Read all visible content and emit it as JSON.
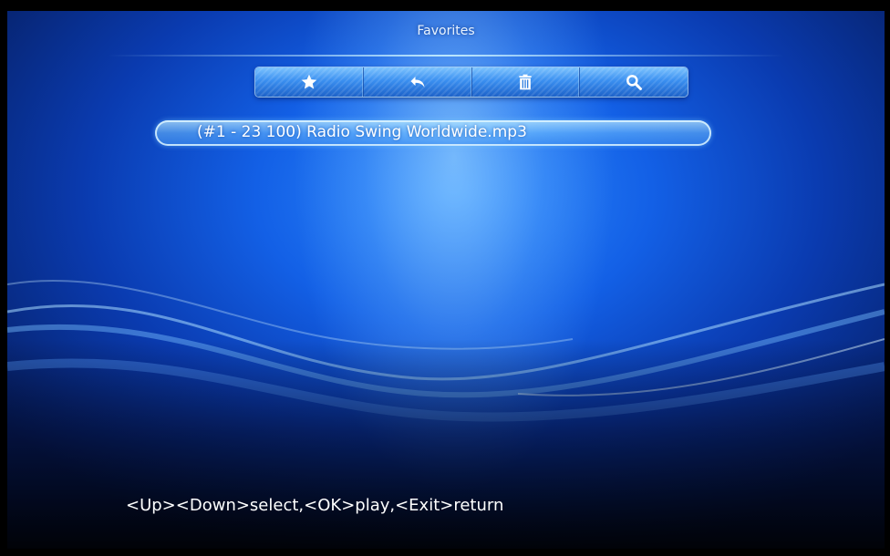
{
  "header": {
    "title": "Favorites"
  },
  "toolbar": {
    "buttons": [
      {
        "icon": "star-icon"
      },
      {
        "icon": "back-arrow-icon"
      },
      {
        "icon": "trash-icon"
      },
      {
        "icon": "search-icon"
      }
    ]
  },
  "list": {
    "items": [
      {
        "label": "(#1 - 23 100) Radio Swing Worldwide.mp3",
        "selected": true
      }
    ]
  },
  "footer": {
    "hint": "<Up><Down>select,<OK>play,<Exit>return"
  },
  "colors": {
    "background": "#000000",
    "accent": "#1360e6",
    "text": "#ffffff"
  }
}
